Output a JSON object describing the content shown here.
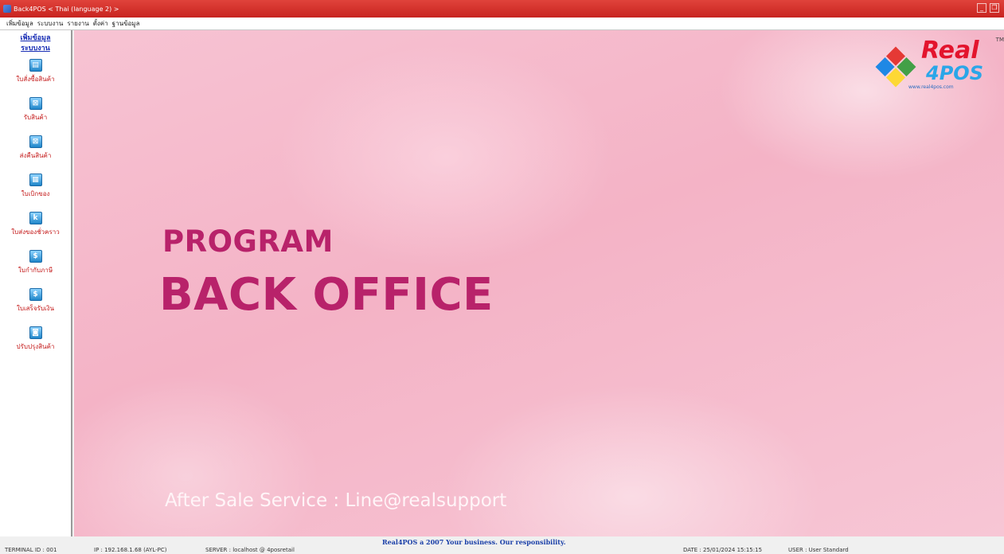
{
  "window": {
    "title": "Back4POS < Thai (language 2) >"
  },
  "menu": [
    "เพิ่มข้อมูล",
    "ระบบงาน",
    "รายงาน",
    "ตั้งค่า",
    "ฐานข้อมูล"
  ],
  "sidebar": {
    "heading": [
      "เพิ่มข้อมูล",
      "ระบบงาน"
    ],
    "items": [
      {
        "label": "ใบสั่งซื้อสินค้า",
        "icon": "document-icon",
        "glyph": "▤"
      },
      {
        "label": "รับสินค้า",
        "icon": "receive-box-icon",
        "glyph": "⊠"
      },
      {
        "label": "ส่งคืนสินค้า",
        "icon": "return-box-icon",
        "glyph": "⊠"
      },
      {
        "label": "ใบเบิกของ",
        "icon": "requisition-icon",
        "glyph": "▦"
      },
      {
        "label": "ใบส่งของชั่วคราว",
        "icon": "delivery-icon",
        "glyph": "k"
      },
      {
        "label": "ใบกำกับภาษี",
        "icon": "tax-invoice-icon",
        "glyph": "$"
      },
      {
        "label": "ใบเสร็จรับเงิน",
        "icon": "receipt-icon",
        "glyph": "$"
      },
      {
        "label": "ปรับปรุงสินค้า",
        "icon": "adjust-stock-icon",
        "glyph": "◙"
      }
    ]
  },
  "banner": {
    "line1": "PROGRAM",
    "line2": "BACK OFFICE",
    "footer": "After Sale Service : Line@realsupport"
  },
  "logo": {
    "word1": "Real",
    "word2": "4POS",
    "tm": "TM",
    "url": "www.real4pos.com"
  },
  "status": {
    "slogan": "Real4POS a 2007 Your business. Our responsibility.",
    "terminal": "TERMINAL ID : 001",
    "ip": "IP : 192.168.1.68 (AYL-PC)",
    "server": "SERVER : localhost @ 4posretail",
    "date": "DATE : 25/01/2024 15:15:15",
    "user": "USER : User Standard"
  },
  "colors": {
    "titlebar": "#d0302a",
    "banner_text": "#b8226a",
    "sidebar_label": "#c41a1a",
    "sidebar_heading": "#1a2fb5"
  }
}
